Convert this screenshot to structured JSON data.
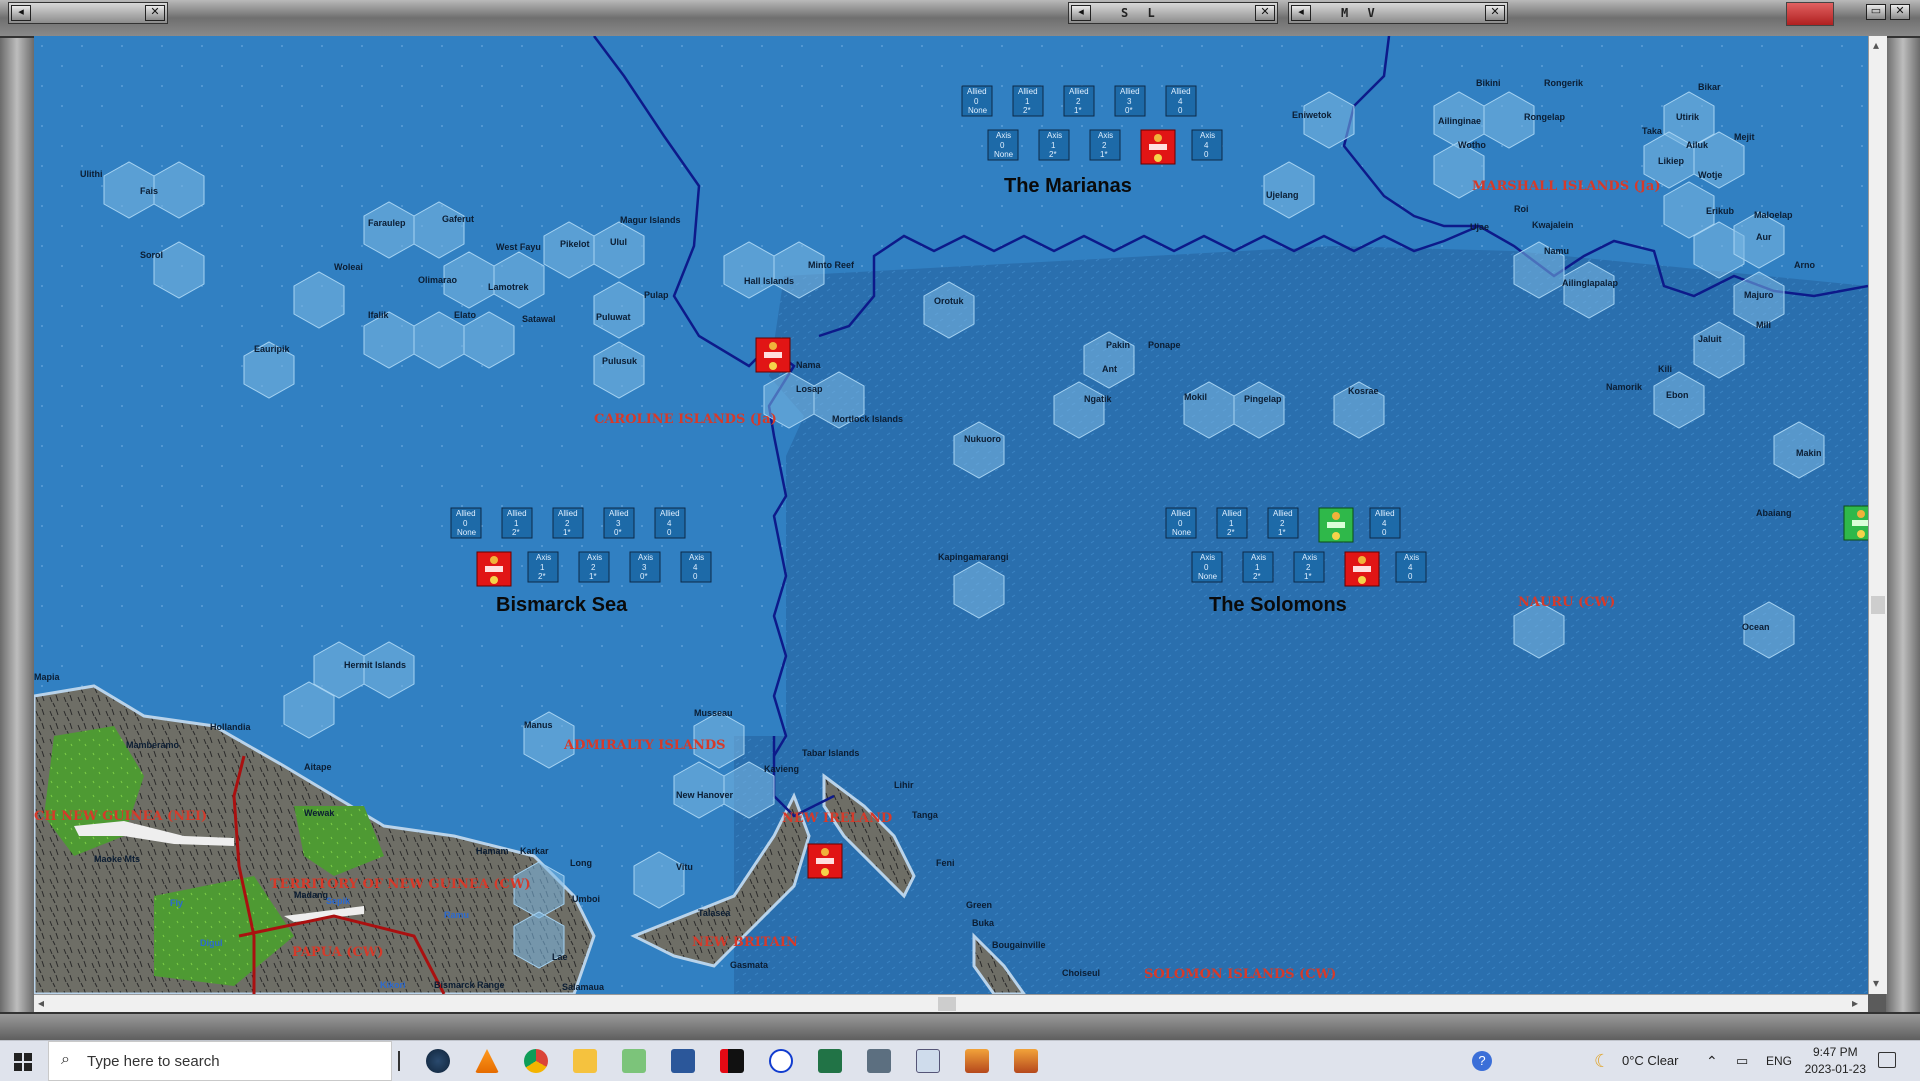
{
  "window": {
    "panel_left": "",
    "panel_sl": "S L",
    "panel_mv": "M V"
  },
  "seas": [
    {
      "name": "The Marianas",
      "allied_labels": [
        "Allied",
        "Allied",
        "Allied",
        "Allied",
        "Allied"
      ],
      "allied_values": [
        "0",
        "1",
        "2",
        "3",
        "4"
      ],
      "allied_sub": [
        "None",
        "2*",
        "1*",
        "0*",
        "0"
      ],
      "axis_labels": [
        "Axis",
        "Axis",
        "Axis",
        "",
        "Axis"
      ],
      "axis_values": [
        "0",
        "1",
        "2",
        "",
        "4"
      ],
      "axis_sub": [
        "None",
        "2*",
        "1*",
        "",
        "0"
      ]
    },
    {
      "name": "Bismarck Sea",
      "allied_labels": [
        "Allied",
        "Allied",
        "Allied",
        "Allied",
        "Allied"
      ],
      "allied_values": [
        "0",
        "1",
        "2",
        "3",
        "4"
      ],
      "allied_sub": [
        "None",
        "2*",
        "1*",
        "0*",
        "0"
      ],
      "axis_labels": [
        "",
        "Axis",
        "Axis",
        "Axis",
        "Axis"
      ],
      "axis_values": [
        "",
        "1",
        "2",
        "3",
        "4"
      ],
      "axis_sub": [
        "",
        "2*",
        "1*",
        "0*",
        "0"
      ]
    },
    {
      "name": "The Solomons",
      "allied_labels": [
        "Allied",
        "Allied",
        "Allied",
        "",
        "Allied"
      ],
      "allied_values": [
        "0",
        "1",
        "2",
        "",
        "4"
      ],
      "allied_sub": [
        "None",
        "2*",
        "1*",
        "",
        "0"
      ],
      "axis_labels": [
        "Axis",
        "Axis",
        "Axis",
        "",
        "Axis"
      ],
      "axis_values": [
        "0",
        "1",
        "2",
        "",
        "4"
      ],
      "axis_sub": [
        "None",
        "2*",
        "1*",
        "",
        "0"
      ]
    }
  ],
  "regions": [
    "CAROLINE ISLANDS (Ja)",
    "MARSHALL ISLANDS (Ja)",
    "NAURU (CW)",
    "ADMIRALTY ISLANDS",
    "NEW IRELAND",
    "NEW BRITAIN",
    "TERRITORY OF NEW GUINEA (CW)",
    "PAPUA (CW)",
    "SOLOMON ISLANDS (CW)",
    "CH NEW GUINEA (NEI)"
  ],
  "islands": [
    "Ulithi",
    "Fais",
    "Sorol",
    "Faraulep",
    "Gaferut",
    "Woleai",
    "Olimarao",
    "West Fayu",
    "Lamotrek",
    "Pikelot",
    "Ulul",
    "Magur Islands",
    "Ifalik",
    "Elato",
    "Satawal",
    "Pulap",
    "Puluwat",
    "Pulusuk",
    "Eauripik",
    "Hall Islands",
    "Minto Reef",
    "Nama",
    "Losap",
    "Mortlock Islands",
    "Orotuk",
    "Nukuoro",
    "Kapingamarangi",
    "Pakin",
    "Ponape",
    "Ant",
    "Ngatik",
    "Mokil",
    "Pingelap",
    "Kosrae",
    "Eniwetok",
    "Ujelang",
    "Bikini",
    "Rongerik",
    "Ailinginae",
    "Rongelap",
    "Wotho",
    "Bikar",
    "Utirik",
    "Taka",
    "Mejit",
    "Ailuk",
    "Likiep",
    "Wotje",
    "Roi",
    "Kwajalein",
    "Ujae",
    "Namu",
    "Ailinglapalap",
    "Erikub",
    "Maloelap",
    "Aur",
    "Arno",
    "Majuro",
    "Mili",
    "Jaluit",
    "Kili",
    "Namorik",
    "Ebon",
    "Makin",
    "Abaiang",
    "Ocean",
    "Hollandia",
    "Mamberamo",
    "Aitape",
    "Wewak",
    "Maoke Mts",
    "Hermit Islands",
    "Manus",
    "Musseau",
    "New Hanover",
    "Kavieng",
    "Tabar Islands",
    "Lihir",
    "Tanga",
    "Feni",
    "Green",
    "Buka",
    "Bougainville",
    "Choiseul",
    "Madang",
    "Karkar",
    "Long",
    "Umboi",
    "Vitu",
    "Gasmata",
    "Lae",
    "Salamaua",
    "Sepik",
    "Ramu",
    "Fly",
    "Digul",
    "Kikori",
    "Bismarck Range",
    "Mapia",
    "Hamam",
    "Talasea"
  ],
  "taskbar": {
    "search_placeholder": "Type here to search",
    "weather": "0°C  Clear",
    "language": "ENG",
    "time": "9:47 PM",
    "date": "2023-01-23"
  }
}
